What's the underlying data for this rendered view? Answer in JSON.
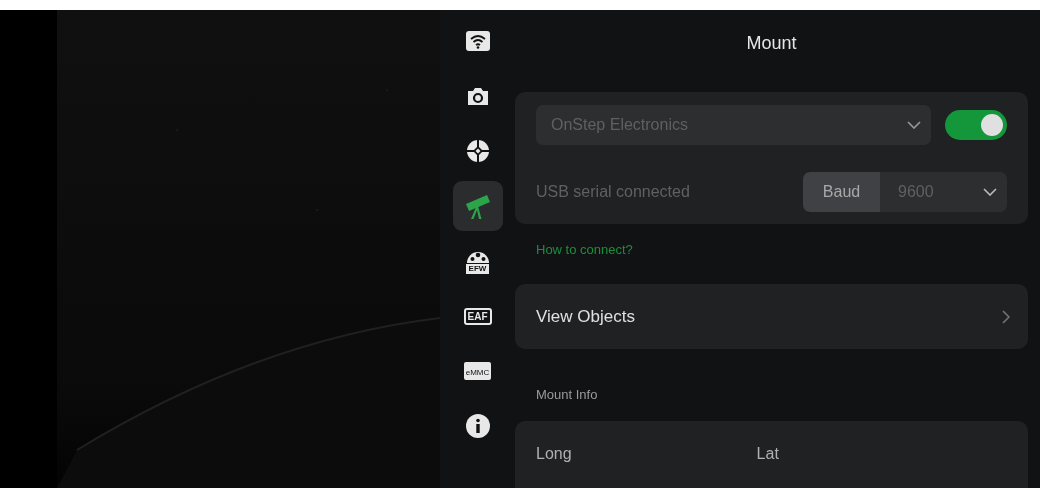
{
  "sidebar": {
    "items": [
      {
        "kind": "wifi",
        "selected": false
      },
      {
        "kind": "camera",
        "selected": false
      },
      {
        "kind": "guide",
        "selected": false
      },
      {
        "kind": "telescope",
        "selected": true
      },
      {
        "kind": "efw",
        "label": "EFW",
        "selected": false
      },
      {
        "kind": "eaf",
        "label": "EAF",
        "selected": false
      },
      {
        "kind": "emmc",
        "label": "eMMC",
        "selected": false
      },
      {
        "kind": "info",
        "selected": false
      }
    ]
  },
  "title": "Mount",
  "mount_card": {
    "device": {
      "value": "OnStep Electronics"
    },
    "enabled": {
      "on": true
    },
    "status": "USB serial connected",
    "baud": {
      "label": "Baud",
      "value": "9600"
    }
  },
  "help_link": "How to connect?",
  "view_objects": "View Objects",
  "info_heading": "Mount Info",
  "info": [
    {
      "label": "Long"
    },
    {
      "label": "Lat"
    }
  ]
}
